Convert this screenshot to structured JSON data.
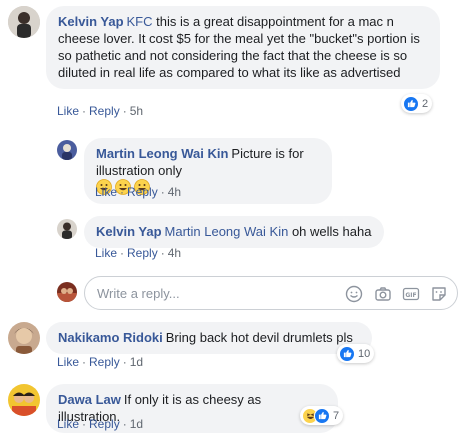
{
  "comments": [
    {
      "author": "Kelvin Yap",
      "tag": "KFC",
      "text": " this is a great disappointment for a mac n cheese lover. It cost $5 for the meal yet the \"bucket\"s portion is so pathetic and not considering the fact that the cheese is so diluted in real life as compared to what its like as advertised",
      "like": "Like",
      "reply": "Reply",
      "time": "5h",
      "reaction_count": "2",
      "replies": [
        {
          "author": "Martin Leong Wai Kin",
          "text": "Picture is for illustration only",
          "emojis": [
            "grinning-face-emoji",
            "grinning-face-emoji",
            "grinning-face-emoji"
          ],
          "like": "Like",
          "reply": "Reply",
          "time": "4h"
        },
        {
          "author": "Kelvin Yap",
          "tag": "Martin Leong Wai Kin",
          "text": " oh wells haha",
          "like": "Like",
          "reply": "Reply",
          "time": "4h"
        }
      ]
    },
    {
      "author": "Nakikamo Ridoki",
      "text": "Bring back hot devil drumlets pls",
      "like": "Like",
      "reply": "Reply",
      "time": "1d",
      "reaction_count": "10"
    },
    {
      "author": "Dawa Law",
      "text": "If only it is as cheesy as illustration.",
      "like": "Like",
      "reply": "Reply",
      "time": "1d",
      "reaction_count": "7"
    }
  ],
  "reply_box": {
    "placeholder": "Write a reply...",
    "tools": [
      "smiley-icon",
      "camera-icon",
      "gif-icon",
      "sticker-icon"
    ]
  },
  "colors": {
    "link": "#385898",
    "bubble": "#f2f3f5",
    "meta": "#606770",
    "like_blue": "#1877f2"
  }
}
